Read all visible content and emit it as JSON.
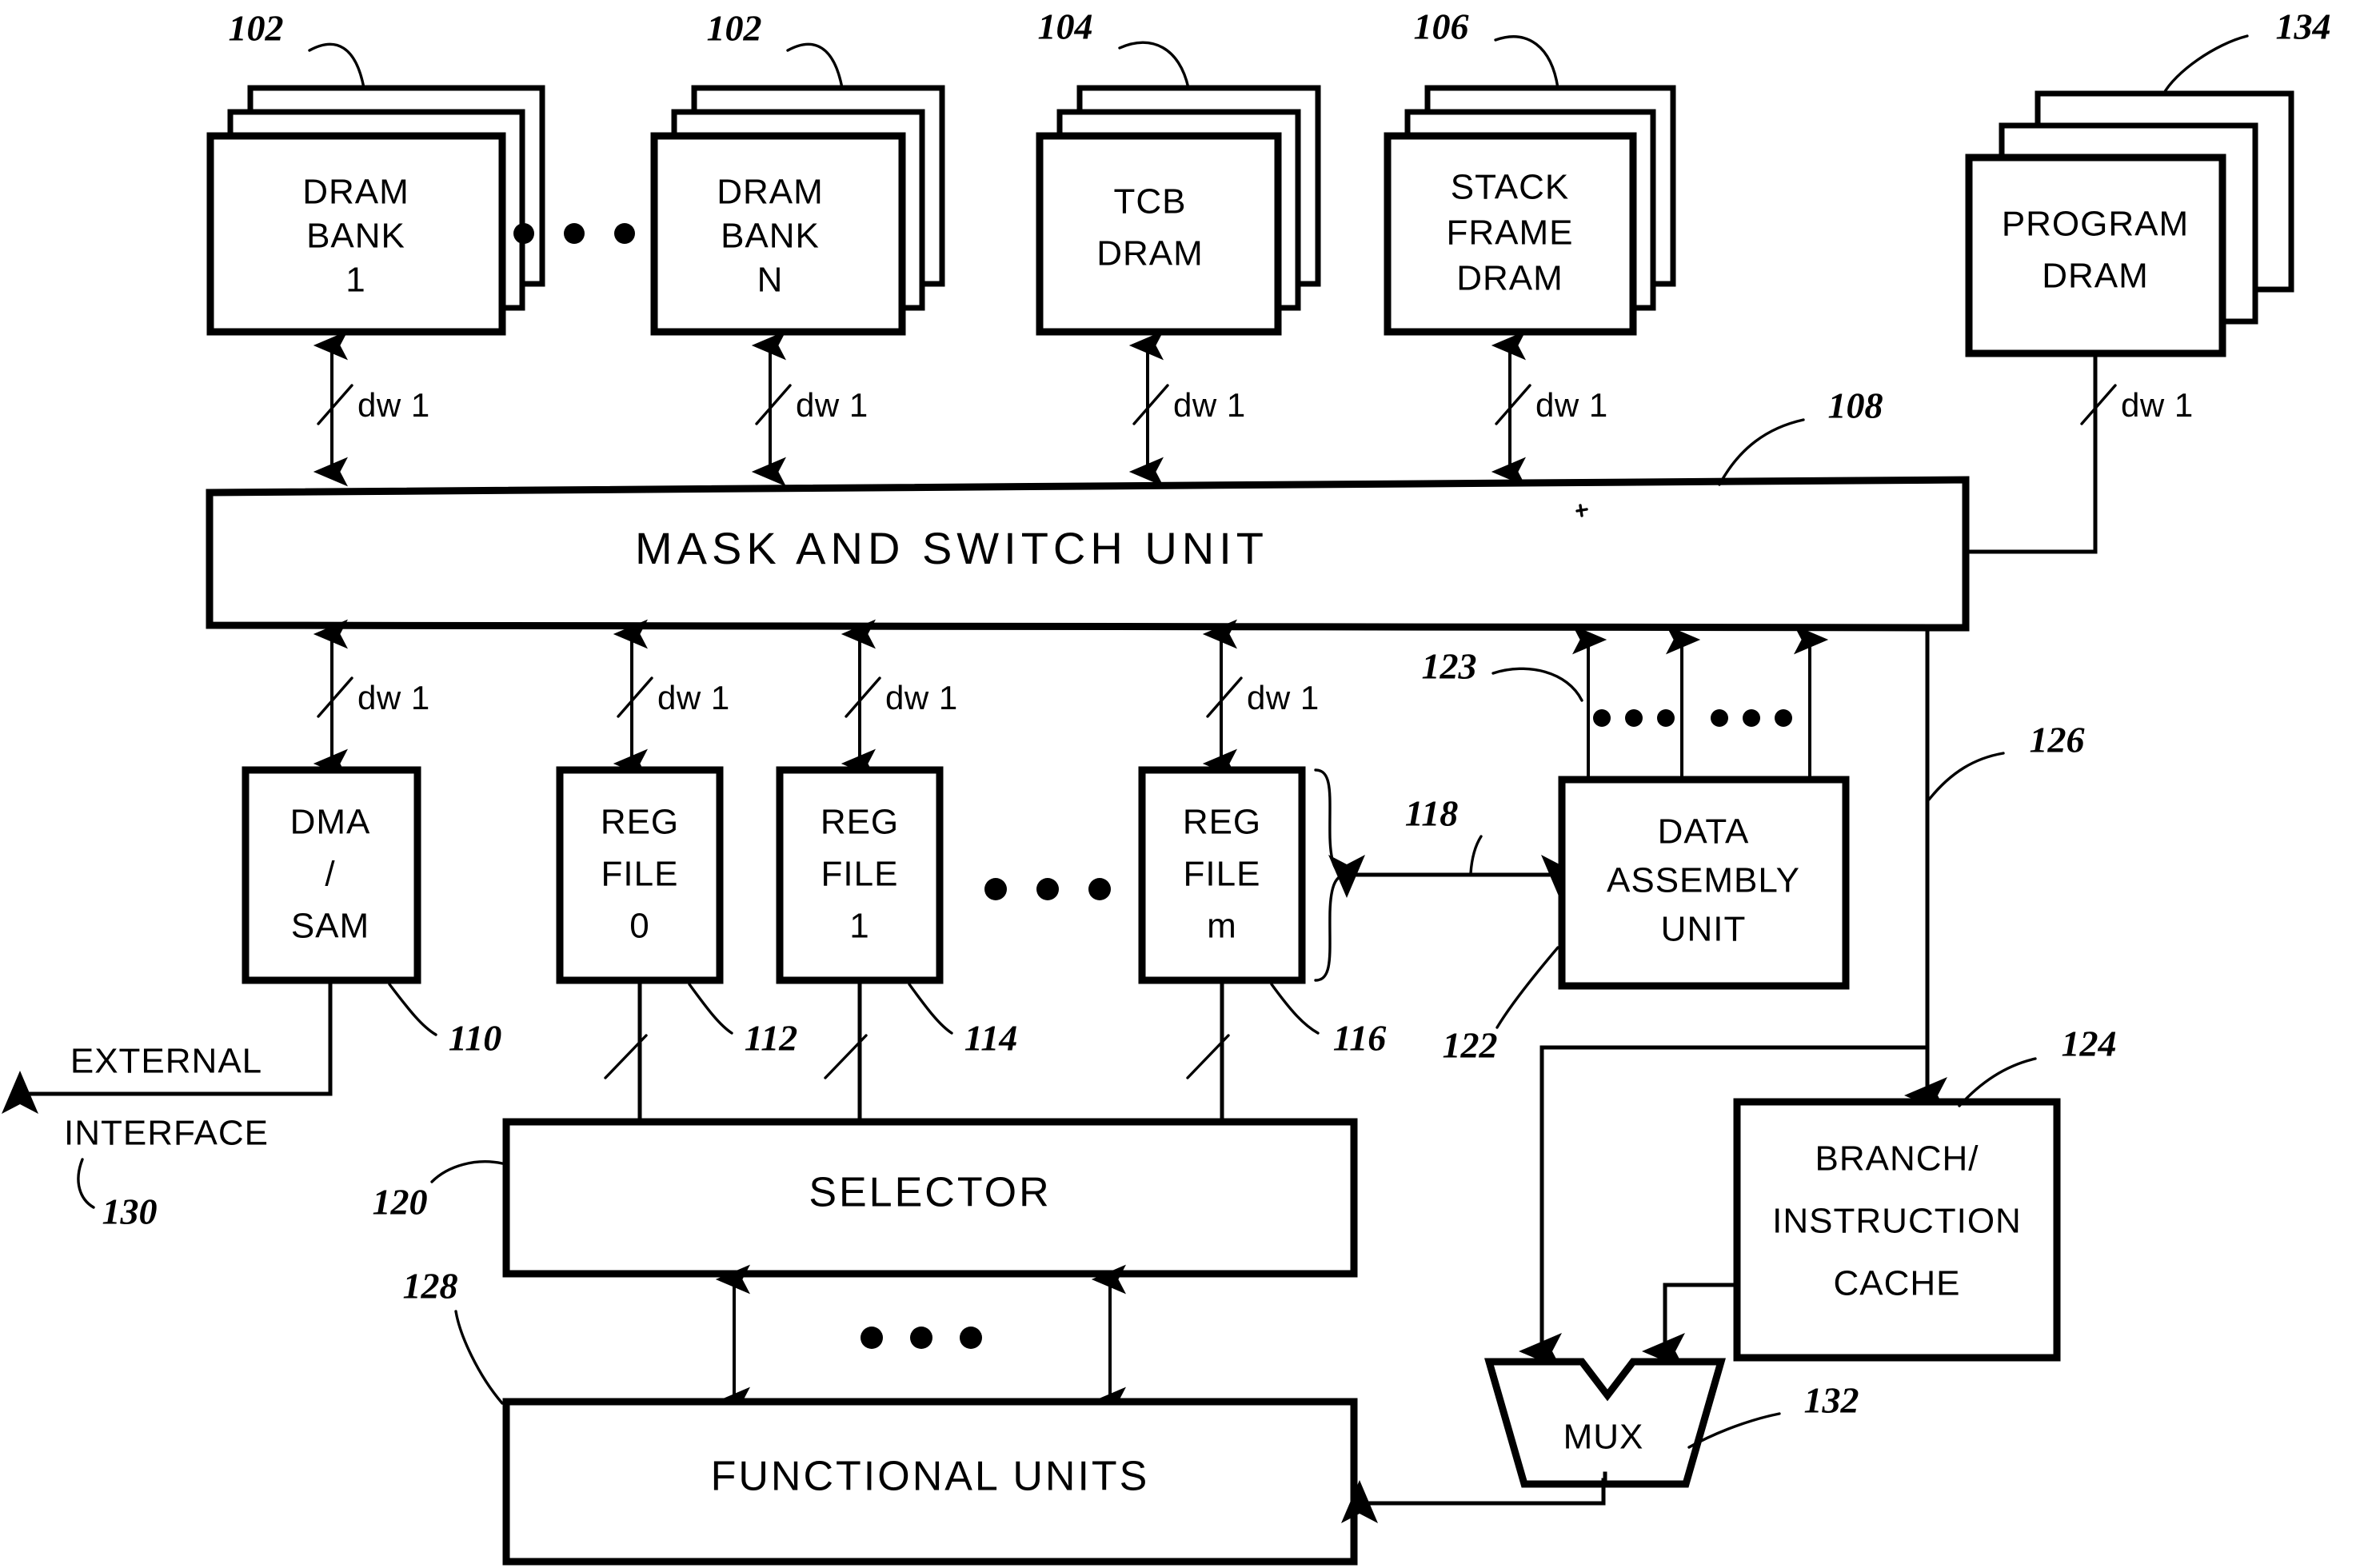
{
  "figure": {
    "type": "patent-block-diagram",
    "blocks": [
      {
        "id": "dram_bank_1",
        "label": "DRAM\nBANK\n1",
        "ref": "102"
      },
      {
        "id": "dram_bank_n",
        "label": "DRAM\nBANK\nN",
        "ref": "102"
      },
      {
        "id": "tcb_dram",
        "label": "TCB\nDRAM",
        "ref": "104"
      },
      {
        "id": "stack_frame",
        "label": "STACK\nFRAME\nDRAM",
        "ref": "106"
      },
      {
        "id": "program_dram",
        "label": "PROGRAM\nDRAM",
        "ref": "134"
      },
      {
        "id": "mask_switch",
        "label": "MASK AND SWITCH UNIT",
        "ref": "108"
      },
      {
        "id": "dma_sam",
        "label": "DMA\n/\nSAM",
        "ref": "110"
      },
      {
        "id": "reg_file_0",
        "label": "REG\nFILE\n0",
        "ref": "112"
      },
      {
        "id": "reg_file_1",
        "label": "REG\nFILE\n1",
        "ref": "114"
      },
      {
        "id": "reg_file_m",
        "label": "REG\nFILE\nm",
        "ref": "116"
      },
      {
        "id": "data_assembly",
        "label": "DATA\nASSEMBLY\nUNIT",
        "ref": "122"
      },
      {
        "id": "selector",
        "label": "SELECTOR",
        "ref": "120"
      },
      {
        "id": "functional",
        "label": "FUNCTIONAL UNITS",
        "ref": "128"
      },
      {
        "id": "branch_cache",
        "label": "BRANCH/\nINSTRUCTION\nCACHE",
        "ref": "124"
      },
      {
        "id": "mux",
        "label": "MUX",
        "ref": "132"
      }
    ],
    "block_text": {
      "dram_bank_1_l1": "DRAM",
      "dram_bank_1_l2": "BANK",
      "dram_bank_1_l3": "1",
      "dram_bank_n_l1": "DRAM",
      "dram_bank_n_l2": "BANK",
      "dram_bank_n_l3": "N",
      "tcb_dram_l1": "TCB",
      "tcb_dram_l2": "DRAM",
      "stack_frame_l1": "STACK",
      "stack_frame_l2": "FRAME",
      "stack_frame_l3": "DRAM",
      "program_dram_l1": "PROGRAM",
      "program_dram_l2": "DRAM",
      "mask_switch_l1": "MASK AND SWITCH UNIT",
      "dma_sam_l1": "DMA",
      "dma_sam_l2": "/",
      "dma_sam_l3": "SAM",
      "reg_file_0_l1": "REG",
      "reg_file_0_l2": "FILE",
      "reg_file_0_l3": "0",
      "reg_file_1_l1": "REG",
      "reg_file_1_l2": "FILE",
      "reg_file_1_l3": "1",
      "reg_file_m_l1": "REG",
      "reg_file_m_l2": "FILE",
      "reg_file_m_l3": "m",
      "data_assembly_l1": "DATA",
      "data_assembly_l2": "ASSEMBLY",
      "data_assembly_l3": "UNIT",
      "selector_l1": "SELECTOR",
      "functional_l1": "FUNCTIONAL UNITS",
      "branch_cache_l1": "BRANCH/",
      "branch_cache_l2": "INSTRUCTION",
      "branch_cache_l3": "CACHE",
      "mux_l1": "MUX",
      "external_l1": "EXTERNAL",
      "external_l2": "INTERFACE"
    },
    "bus_labels": {
      "dw1_dram1": "dw 1",
      "dw1_dramN": "dw 1",
      "dw1_tcb": "dw 1",
      "dw1_stack": "dw 1",
      "dw1_program": "dw 1",
      "dw1_dma": "dw 1",
      "dw1_rf0": "dw 1",
      "dw1_rf1": "dw 1",
      "dw1_rfm": "dw 1"
    },
    "reference_numerals": {
      "r102a": "102",
      "r102b": "102",
      "r104": "104",
      "r106": "106",
      "r108": "108",
      "r110": "110",
      "r112": "112",
      "r114": "114",
      "r116": "116",
      "r118": "118",
      "r120": "120",
      "r122": "122",
      "r123": "123",
      "r124": "124",
      "r126": "126",
      "r128": "128",
      "r130": "130",
      "r132": "132",
      "r134": "134"
    },
    "colors": {
      "ink": "#000000",
      "paper": "#ffffff"
    }
  }
}
